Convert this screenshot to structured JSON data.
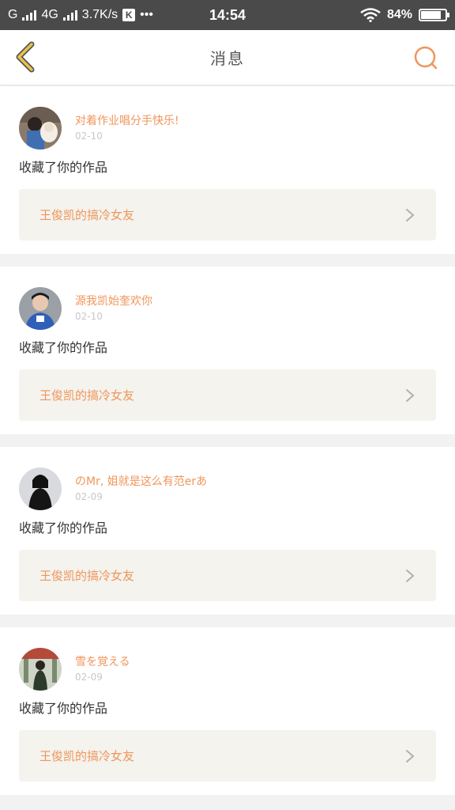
{
  "status_bar": {
    "carrier_1": "G",
    "network": "4G",
    "speed": "3.7K/s",
    "app_badge": "K",
    "more": "•••",
    "time": "14:54",
    "battery_percent": "84%",
    "battery_level": 0.84
  },
  "nav": {
    "title": "消息",
    "back_icon": "chevron-left-icon",
    "search_icon": "search-icon"
  },
  "colors": {
    "accent": "#f0955a",
    "back_chevron": "#e8c34a",
    "card_bg": "#f4f3ee"
  },
  "messages": [
    {
      "nickname": "对着作业唱分手快乐!",
      "date": "02-10",
      "action": "收藏了你的作品",
      "work_title": "王俊凯的搞冷女友"
    },
    {
      "nickname": "源我凯始奎欢你",
      "date": "02-10",
      "action": "收藏了你的作品",
      "work_title": "王俊凯的搞冷女友"
    },
    {
      "nickname": "のMr, 姐就是这么有范erあ",
      "date": "02-09",
      "action": "收藏了你的作品",
      "work_title": "王俊凯的搞冷女友"
    },
    {
      "nickname": "雪を覚える",
      "date": "02-09",
      "action": "收藏了你的作品",
      "work_title": "王俊凯的搞冷女友"
    }
  ]
}
